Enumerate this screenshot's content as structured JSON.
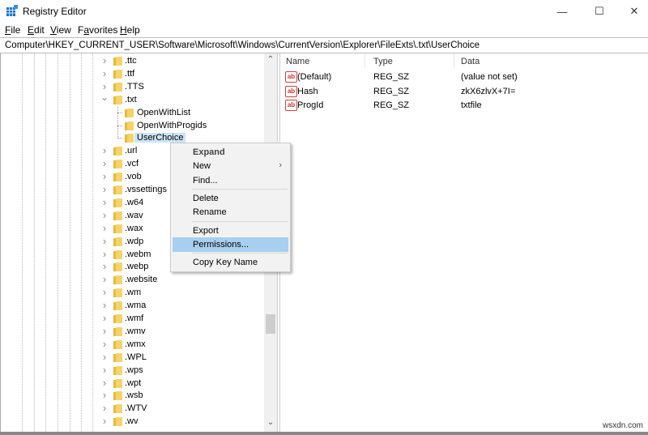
{
  "window": {
    "title": "Registry Editor",
    "minimize_glyph": "—",
    "maximize_glyph": "☐",
    "close_glyph": "✕"
  },
  "menubar": {
    "items": [
      {
        "label": "File",
        "accel": "F",
        "rest": "ile"
      },
      {
        "label": "Edit",
        "accel": "E",
        "rest": "dit"
      },
      {
        "label": "View",
        "accel": "V",
        "rest": "iew"
      },
      {
        "label": "Favorites",
        "accel": "a",
        "pre": "F",
        "rest": "vorites"
      },
      {
        "label": "Help",
        "accel": "H",
        "rest": "elp"
      }
    ]
  },
  "address": "Computer\\HKEY_CURRENT_USER\\Software\\Microsoft\\Windows\\CurrentVersion\\Explorer\\FileExts\\.txt\\UserChoice",
  "tree": {
    "items": [
      {
        "label": ".ttc",
        "level": 0,
        "state": "collapsed"
      },
      {
        "label": ".ttf",
        "level": 0,
        "state": "collapsed"
      },
      {
        "label": ".TTS",
        "level": 0,
        "state": "collapsed"
      },
      {
        "label": ".txt",
        "level": 0,
        "state": "expanded"
      },
      {
        "label": "OpenWithList",
        "level": 1,
        "state": "leaf"
      },
      {
        "label": "OpenWithProgids",
        "level": 1,
        "state": "leaf"
      },
      {
        "label": "UserChoice",
        "level": 1,
        "state": "leaf",
        "selected": true
      },
      {
        "label": ".url",
        "level": 0,
        "state": "collapsed"
      },
      {
        "label": ".vcf",
        "level": 0,
        "state": "collapsed"
      },
      {
        "label": ".vob",
        "level": 0,
        "state": "collapsed"
      },
      {
        "label": ".vssettings",
        "level": 0,
        "state": "collapsed"
      },
      {
        "label": ".w64",
        "level": 0,
        "state": "collapsed"
      },
      {
        "label": ".wav",
        "level": 0,
        "state": "collapsed"
      },
      {
        "label": ".wax",
        "level": 0,
        "state": "collapsed"
      },
      {
        "label": ".wdp",
        "level": 0,
        "state": "collapsed"
      },
      {
        "label": ".webm",
        "level": 0,
        "state": "collapsed"
      },
      {
        "label": ".webp",
        "level": 0,
        "state": "collapsed"
      },
      {
        "label": ".website",
        "level": 0,
        "state": "collapsed"
      },
      {
        "label": ".wm",
        "level": 0,
        "state": "collapsed"
      },
      {
        "label": ".wma",
        "level": 0,
        "state": "collapsed"
      },
      {
        "label": ".wmf",
        "level": 0,
        "state": "collapsed"
      },
      {
        "label": ".wmv",
        "level": 0,
        "state": "collapsed"
      },
      {
        "label": ".wmx",
        "level": 0,
        "state": "collapsed"
      },
      {
        "label": ".WPL",
        "level": 0,
        "state": "collapsed"
      },
      {
        "label": ".wps",
        "level": 0,
        "state": "collapsed"
      },
      {
        "label": ".wpt",
        "level": 0,
        "state": "collapsed"
      },
      {
        "label": ".wsb",
        "level": 0,
        "state": "collapsed"
      },
      {
        "label": ".WTV",
        "level": 0,
        "state": "collapsed"
      },
      {
        "label": ".wv",
        "level": 0,
        "state": "collapsed"
      }
    ]
  },
  "values": {
    "columns": [
      "Name",
      "Type",
      "Data"
    ],
    "rows": [
      {
        "icon": "ab",
        "name": "(Default)",
        "type": "REG_SZ",
        "data": "(value not set)"
      },
      {
        "icon": "ab",
        "name": "Hash",
        "type": "REG_SZ",
        "data": "zkX6zlvX+7I="
      },
      {
        "icon": "ab",
        "name": "ProgId",
        "type": "REG_SZ",
        "data": "txtfile"
      }
    ]
  },
  "context_menu": {
    "items": [
      {
        "label": "Expand",
        "bold": true
      },
      {
        "label": "New",
        "submenu": true
      },
      {
        "label": "Find..."
      },
      {
        "separator": true
      },
      {
        "label": "Delete"
      },
      {
        "label": "Rename"
      },
      {
        "separator": true
      },
      {
        "label": "Export"
      },
      {
        "label": "Permissions...",
        "highlighted": true
      },
      {
        "separator": true
      },
      {
        "label": "Copy Key Name"
      }
    ],
    "submenu_glyph": "›"
  },
  "colors": {
    "selection": "#cce4f7",
    "menu_highlight": "#a8cff0",
    "folder": "#f5d36b",
    "string_icon": "#c33333"
  },
  "watermark": "wsxdn.com"
}
